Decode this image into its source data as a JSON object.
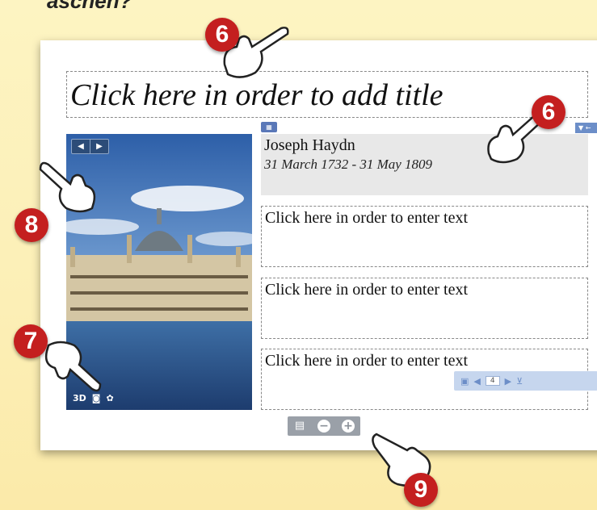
{
  "fragment": "aschen?",
  "slide": {
    "title_placeholder": "Click here in order to add title",
    "name": "Joseph Haydn",
    "dates": "31 March 1732 - 31 May 1809",
    "text_placeholders": [
      "Click here in order to enter text",
      "Click here in order to enter text",
      "Click here in order to enter text"
    ]
  },
  "photo_nav": {
    "prev_icon": "◀",
    "next_icon": "▶"
  },
  "photo_tools": {
    "view3d_label": "3D",
    "camera_icon": "camera-icon",
    "settings_icon": "gear-icon"
  },
  "pager": {
    "page": "4"
  },
  "callouts": [
    "6",
    "6",
    "7",
    "8",
    "9"
  ],
  "colors": {
    "badge": "#c41f1f",
    "nav": "#2c4c78",
    "pager": "#c6d6ee"
  }
}
